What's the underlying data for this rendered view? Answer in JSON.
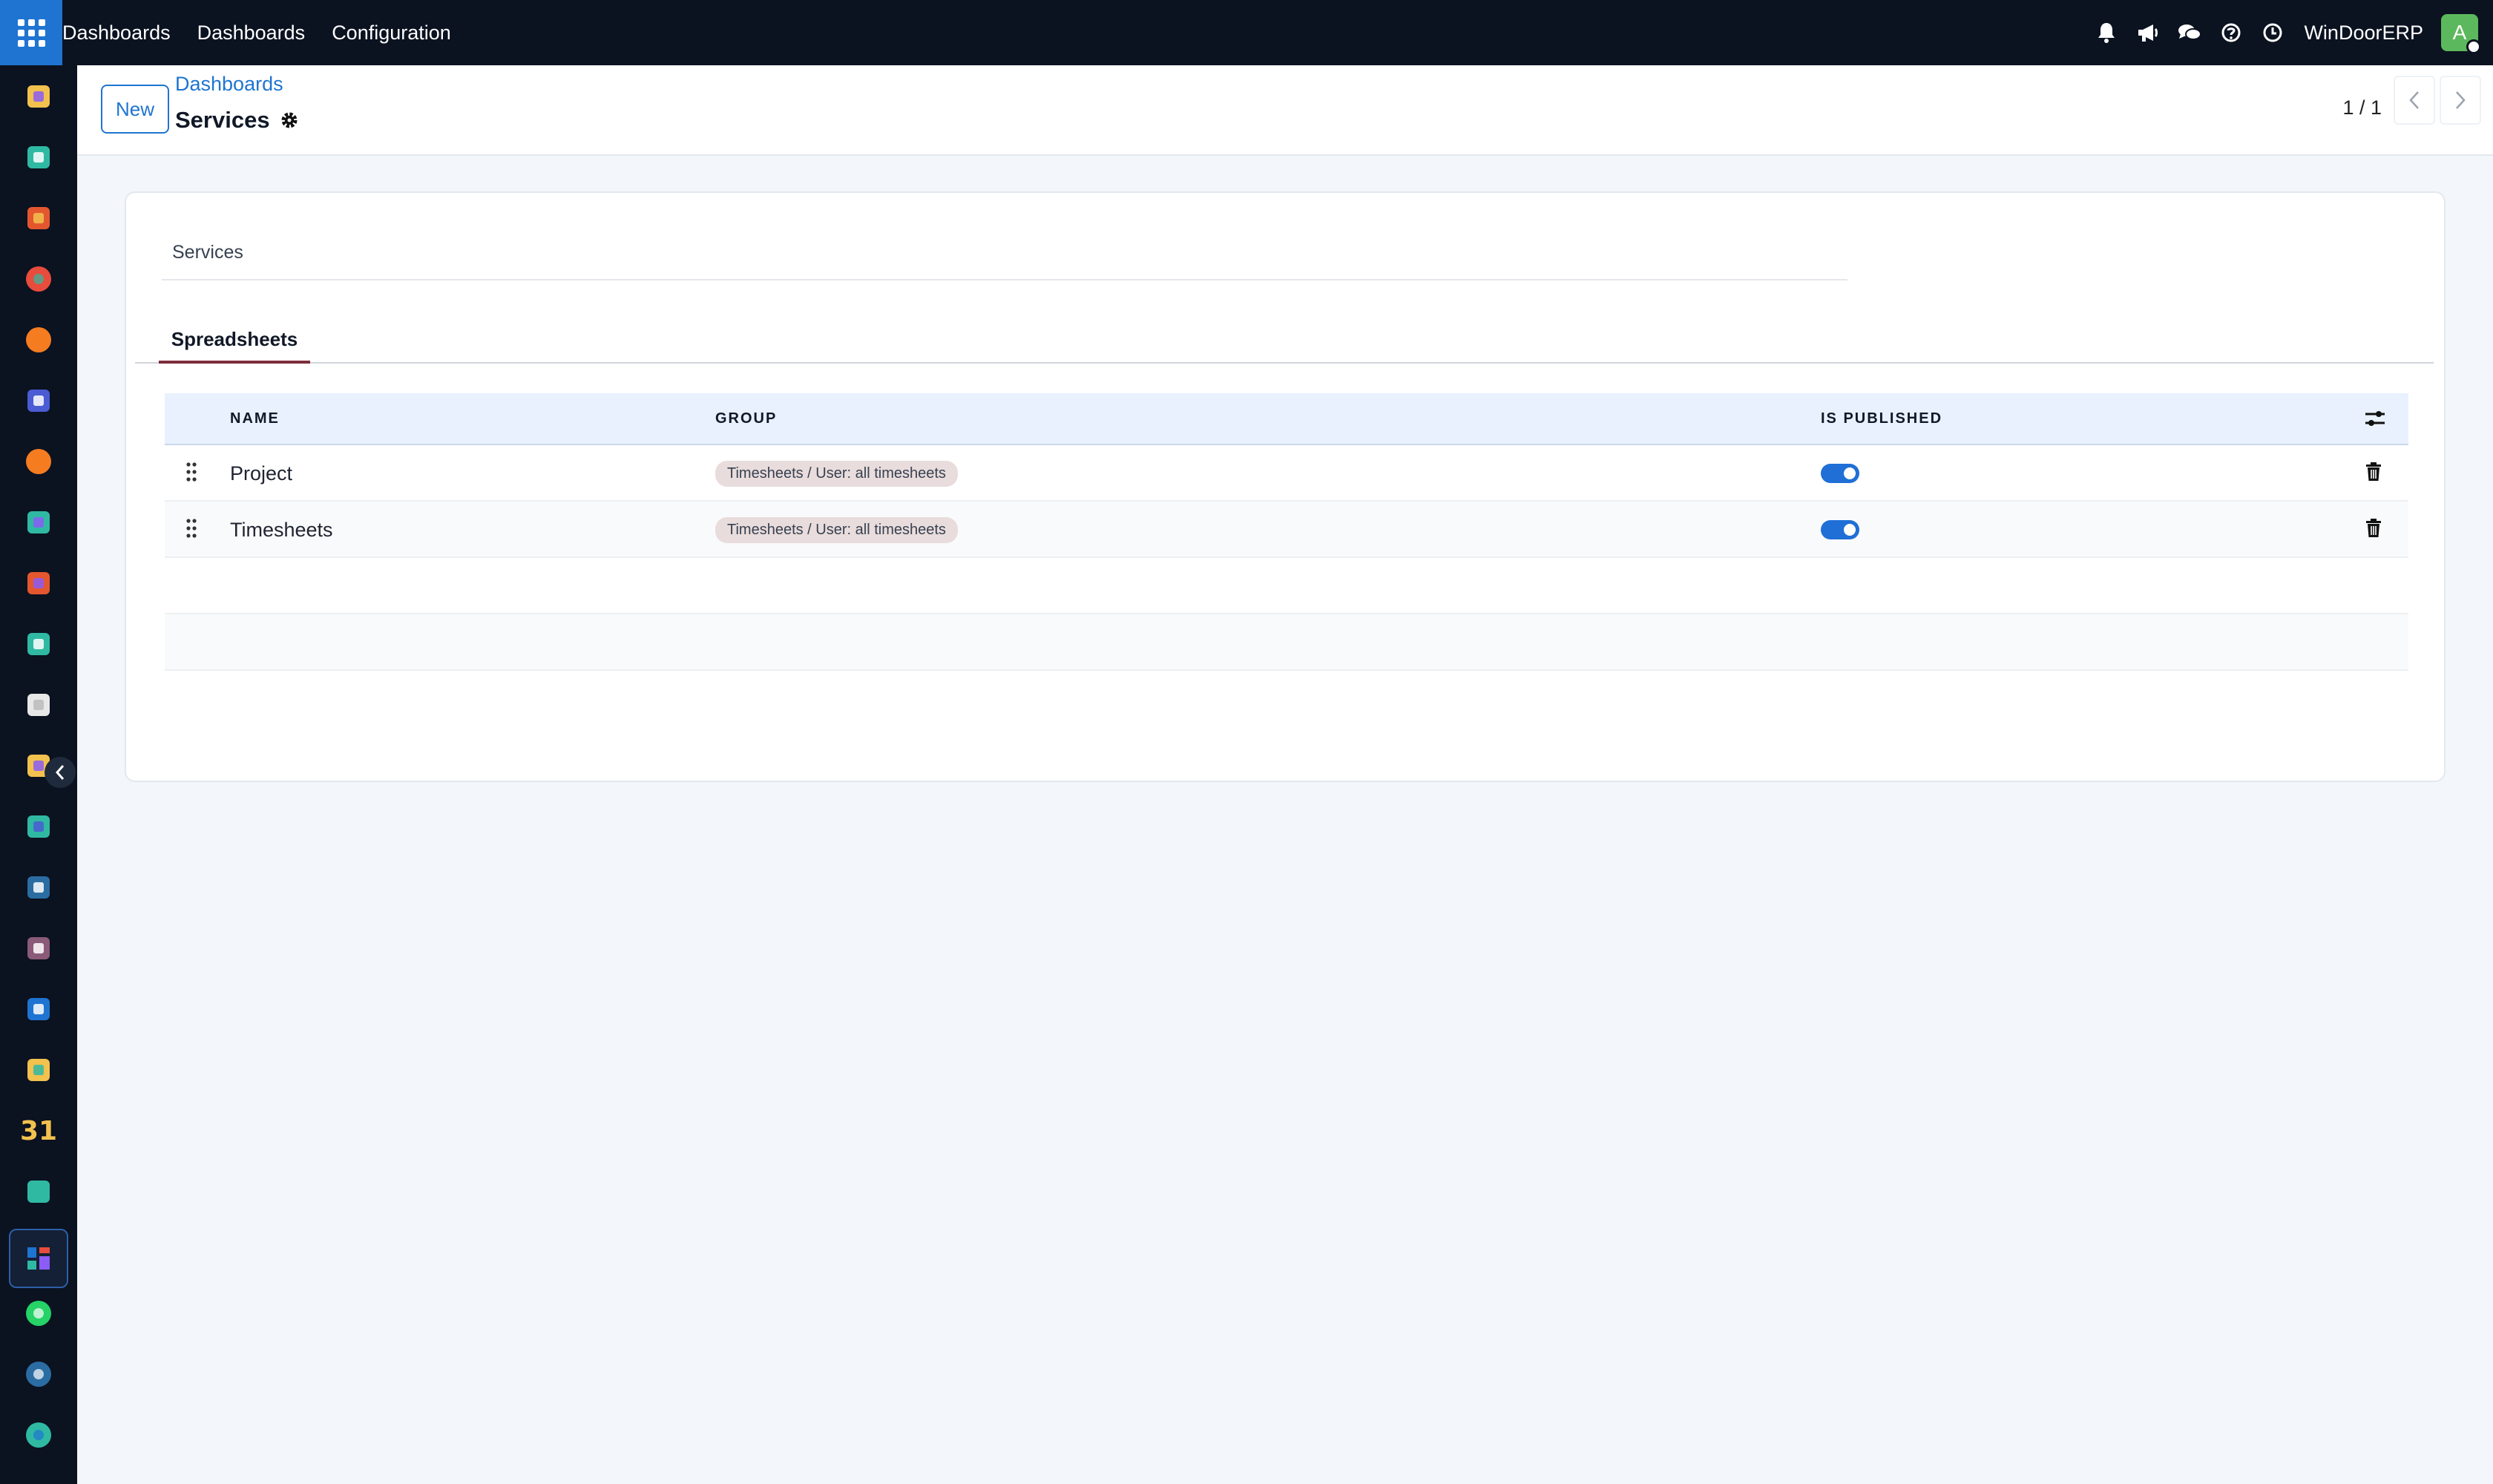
{
  "topbar": {
    "brand": "Dashboards",
    "menu": [
      "Dashboards",
      "Configuration"
    ],
    "company": "WinDoorERP",
    "avatar_letter": "A",
    "icons": [
      "bell-icon",
      "megaphone-icon",
      "chat-icon",
      "help-icon",
      "clock-icon"
    ]
  },
  "sidebar": {
    "apps": [
      "sign-app-icon",
      "contacts-app-icon",
      "reporting-app-icon",
      "pie-app-icon",
      "discuss-app-icon",
      "mail-app-icon",
      "livechat-app-icon",
      "arrows-app-icon",
      "spreadsheet-app-icon",
      "employees-app-icon",
      "inventory-app-icon",
      "sign2-app-icon",
      "todo-app-icon",
      "knowledge-app-icon",
      "products-app-icon",
      "sales-app-icon",
      "team-app-icon",
      "calendar-app-icon",
      "edit-app-icon",
      "dashboards-app-icon",
      "whatsapp-app-icon",
      "clock-app-icon",
      "website-app-icon"
    ],
    "calendar_day": "31"
  },
  "control": {
    "new_label": "New",
    "breadcrumb": "Dashboards",
    "title": "Services",
    "pager": "1 / 1"
  },
  "form": {
    "name_value": "Services",
    "tab_label": "Spreadsheets"
  },
  "table": {
    "columns": {
      "name": "NAME",
      "group": "GROUP",
      "published": "IS PUBLISHED"
    },
    "rows": [
      {
        "name": "Project",
        "group": "Timesheets / User: all timesheets",
        "published": true
      },
      {
        "name": "Timesheets",
        "group": "Timesheets / User: all timesheets",
        "published": true
      }
    ]
  },
  "colors": {
    "primary": "#1f74d1",
    "navbar": "#0b1220",
    "tab_underline": "#7c2d3b",
    "avatar": "#5cb85c"
  }
}
